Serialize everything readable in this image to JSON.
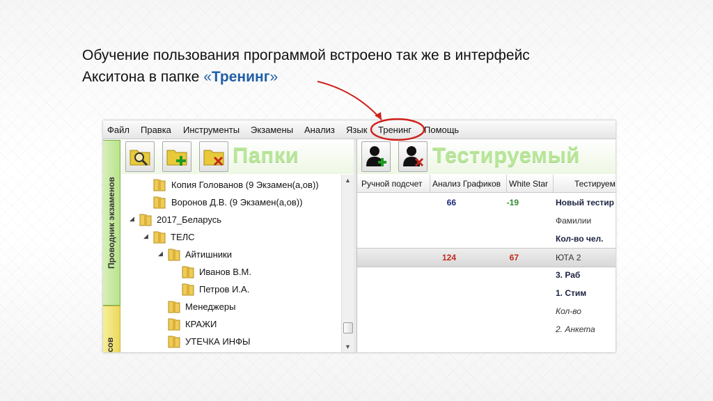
{
  "caption": {
    "line1": "Обучение пользования программой встроено так же в интерфейс",
    "line2_prefix": "Акситона в папке ",
    "quote_open": "«",
    "highlight": "Тренинг",
    "quote_close": "»"
  },
  "menu": [
    "Файл",
    "Правка",
    "Инструменты",
    "Экзамены",
    "Анализ",
    "Язык",
    "Тренинг",
    "Помощь"
  ],
  "side_tabs": {
    "primary": "Проводник экзаменов",
    "secondary": "сов"
  },
  "left_pane": {
    "title": "Папки",
    "buttons": [
      "search-folder-icon",
      "add-folder-icon",
      "delete-folder-icon"
    ],
    "tree": [
      {
        "label": "Копия Голованов  (9 Экзамен(а,ов))",
        "level": 1,
        "arrow": ""
      },
      {
        "label": "Воронов Д.В. (9 Экзамен(а,ов))",
        "level": 1,
        "arrow": ""
      },
      {
        "label": "2017_Беларусь",
        "level": 0,
        "arrow": "◢"
      },
      {
        "label": "ТЕЛС",
        "level": 1,
        "arrow": "◢"
      },
      {
        "label": "Айтишники",
        "level": 2,
        "arrow": "◢"
      },
      {
        "label": "Иванов В.М.",
        "level": 3,
        "arrow": ""
      },
      {
        "label": "Петров И.А.",
        "level": 3,
        "arrow": ""
      },
      {
        "label": "Менеджеры",
        "level": 2,
        "arrow": ""
      },
      {
        "label": "КРАЖИ",
        "level": 2,
        "arrow": ""
      },
      {
        "label": "УТЕЧКА ИНФЫ",
        "level": 2,
        "arrow": ""
      }
    ]
  },
  "right_pane": {
    "title": "Тестируемый",
    "buttons": [
      "add-person-icon",
      "delete-person-icon"
    ],
    "columns": [
      "Ручной подсчет",
      "Анализ Графиков",
      "White Star",
      "Тестируем"
    ],
    "rows": [
      {
        "v1": "66",
        "v1_color": "#1a2a7a",
        "v2": "-19",
        "v2_color": "#2e8b2e",
        "text": "Новый тестир",
        "style": "bold",
        "selected": false
      },
      {
        "v1": "",
        "v1_color": "",
        "v2": "",
        "v2_color": "",
        "text": "Фамилии",
        "style": "normal",
        "selected": false
      },
      {
        "v1": "",
        "v1_color": "",
        "v2": "",
        "v2_color": "",
        "text": "Кол-во чел.",
        "style": "bold",
        "selected": false
      },
      {
        "v1": "124",
        "v1_color": "#c0281b",
        "v2": "67",
        "v2_color": "#c0281b",
        "text": "ЮТА 2",
        "style": "normal",
        "selected": true
      },
      {
        "v1": "",
        "v1_color": "",
        "v2": "",
        "v2_color": "",
        "text": "3. Раб",
        "style": "bold",
        "selected": false
      },
      {
        "v1": "",
        "v1_color": "",
        "v2": "",
        "v2_color": "",
        "text": "1. Стим",
        "style": "bold",
        "selected": false
      },
      {
        "v1": "",
        "v1_color": "",
        "v2": "",
        "v2_color": "",
        "text": "Кол-во",
        "style": "italic",
        "selected": false
      },
      {
        "v1": "",
        "v1_color": "",
        "v2": "",
        "v2_color": "",
        "text": "2. Анкета",
        "style": "italic",
        "selected": false
      }
    ]
  },
  "colors": {
    "accent_text": "#1f5fa8",
    "annotation": "#d0201b",
    "title_watermark": "#b8e69a"
  }
}
